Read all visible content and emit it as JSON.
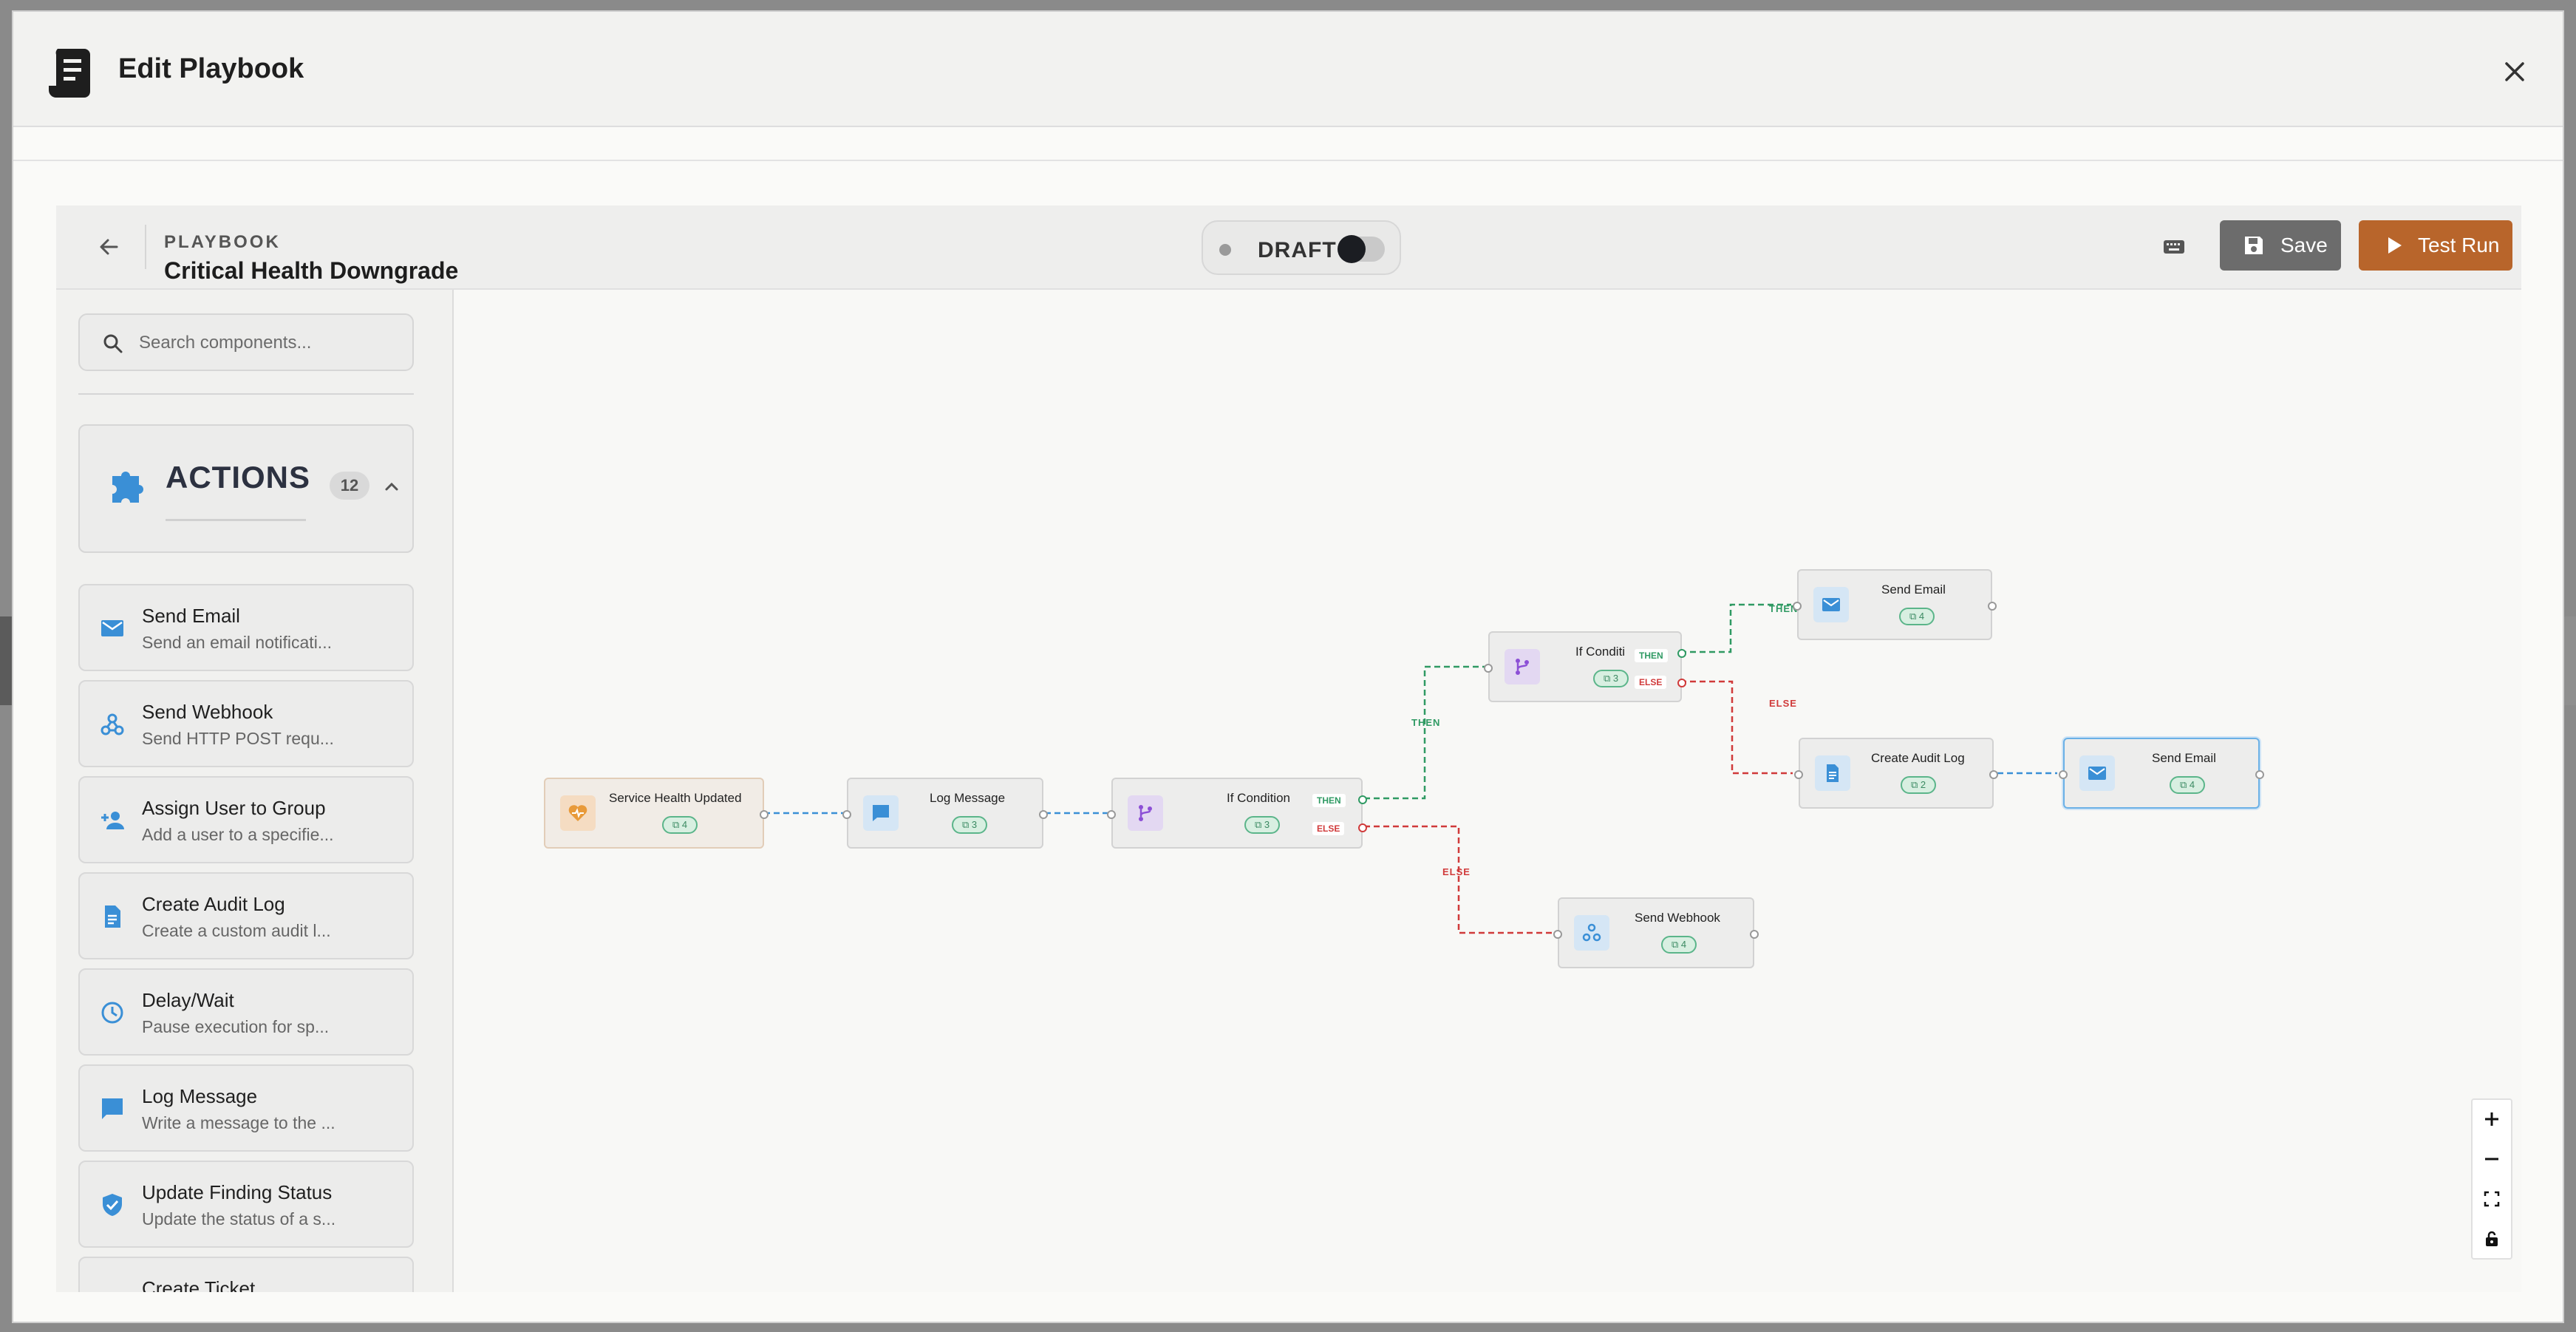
{
  "modal": {
    "title": "Edit Playbook"
  },
  "playbook": {
    "label": "PLAYBOOK",
    "name": "Critical Health Downgrade"
  },
  "status": {
    "label": "DRAFT"
  },
  "toolbar": {
    "save_label": "Save",
    "test_run_label": "Test Run"
  },
  "sidebar": {
    "search_placeholder": "Search components...",
    "section": {
      "title": "ACTIONS",
      "count": "12"
    },
    "items": [
      {
        "name": "Send Email",
        "desc": "Send an email notificati...",
        "icon": "email-icon"
      },
      {
        "name": "Send Webhook",
        "desc": "Send HTTP POST requ...",
        "icon": "webhook-icon"
      },
      {
        "name": "Assign User to Group",
        "desc": "Add a user to a specifie...",
        "icon": "person-add-icon"
      },
      {
        "name": "Create Audit Log",
        "desc": "Create a custom audit l...",
        "icon": "document-icon"
      },
      {
        "name": "Delay/Wait",
        "desc": "Pause execution for sp...",
        "icon": "clock-icon"
      },
      {
        "name": "Log Message",
        "desc": "Write a message to the ...",
        "icon": "chat-icon"
      },
      {
        "name": "Update Finding Status",
        "desc": "Update the status of a s...",
        "icon": "shield-check-icon"
      },
      {
        "name": "Create Ticket",
        "desc": "",
        "icon": "ticket-icon"
      }
    ]
  },
  "canvas": {
    "nodes": [
      {
        "id": "trigger",
        "label": "Service Health Updated",
        "badge": "4"
      },
      {
        "id": "log",
        "label": "Log Message",
        "badge": "3"
      },
      {
        "id": "if1",
        "label": "If Condition",
        "badge": "3"
      },
      {
        "id": "if2",
        "label": "If Conditi",
        "badge": "3"
      },
      {
        "id": "email1",
        "label": "Send Email",
        "badge": "4"
      },
      {
        "id": "audit",
        "label": "Create Audit Log",
        "badge": "2"
      },
      {
        "id": "email2",
        "label": "Send Email",
        "badge": "4"
      },
      {
        "id": "webhook",
        "label": "Send Webhook",
        "badge": "4"
      }
    ],
    "branch_labels": {
      "then": "THEN",
      "else": "ELSE"
    }
  },
  "colors": {
    "accent": "#b8652b",
    "then": "#2f9a63",
    "else": "#d03a3a",
    "edge": "#3a8fd6",
    "action_icon": "#3a8fd6"
  }
}
